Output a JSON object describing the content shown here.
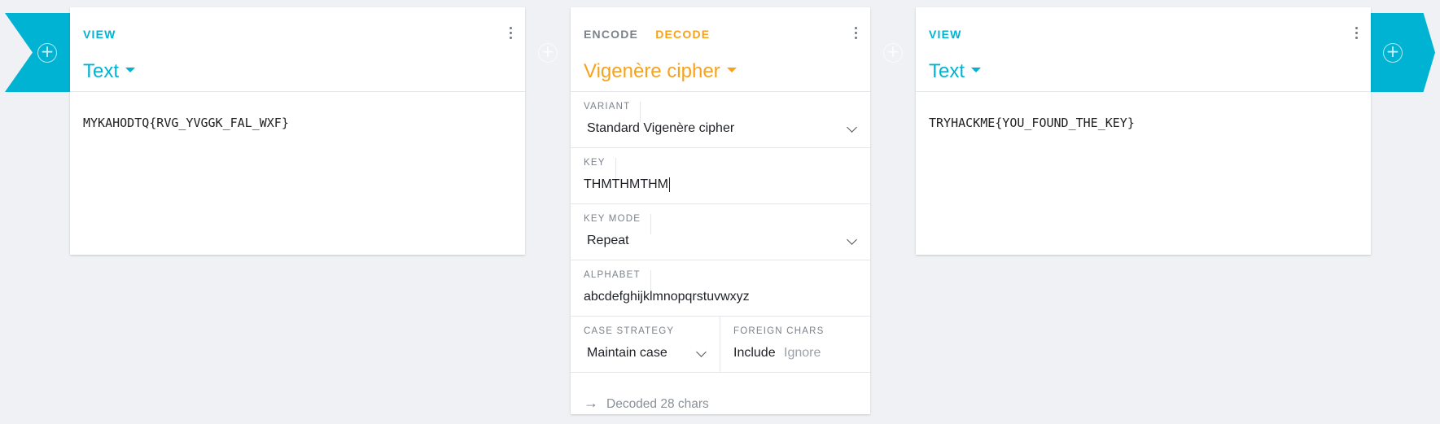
{
  "colors": {
    "accent": "#00b3d3",
    "decode": "#f7a21a",
    "muted": "#7b828a"
  },
  "left_card": {
    "tab": "VIEW",
    "title": "Text",
    "content": "MYKAHODTQ{RVG_YVGGK_FAL_WXF}"
  },
  "mid_card": {
    "tabs": [
      "ENCODE",
      "DECODE"
    ],
    "active_tab": "DECODE",
    "title": "Vigenère cipher",
    "fields": {
      "variant": {
        "label": "VARIANT",
        "value": "Standard Vigenère cipher"
      },
      "key": {
        "label": "KEY",
        "value": "THMTHMTHM"
      },
      "key_mode": {
        "label": "KEY MODE",
        "value": "Repeat"
      },
      "alphabet": {
        "label": "ALPHABET",
        "value": "abcdefghijklmnopqrstuvwxyz"
      },
      "case_strategy": {
        "label": "CASE STRATEGY",
        "value": "Maintain case"
      },
      "foreign_chars": {
        "label": "FOREIGN CHARS",
        "options": [
          "Include",
          "Ignore"
        ],
        "selected": "Include"
      }
    },
    "footer": "Decoded 28 chars"
  },
  "right_card": {
    "tab": "VIEW",
    "title": "Text",
    "content": "TRYHACKME{YOU_FOUND_THE_KEY}"
  },
  "icons": [
    "add-circle-icon",
    "more-vert-icon",
    "caret-down-icon",
    "chevron-down-icon",
    "arrow-right-icon"
  ]
}
